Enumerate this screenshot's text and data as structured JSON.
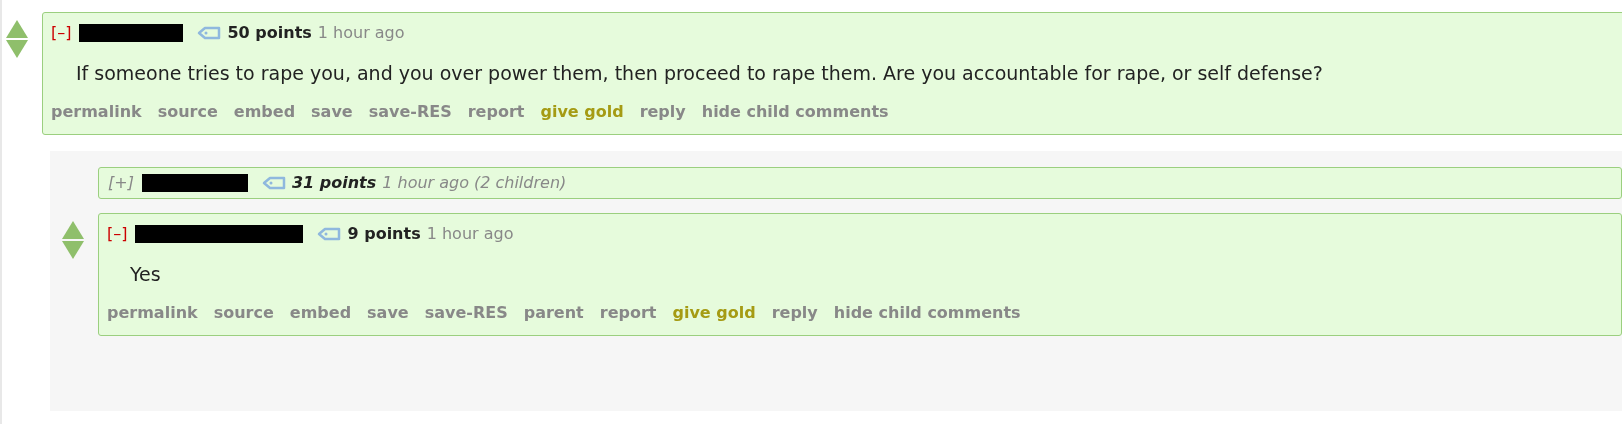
{
  "comments": [
    {
      "toggle": "[–]",
      "collapsed": false,
      "points": "50 points",
      "time": "1 hour ago",
      "body": "If someone tries to rape you, and you over power them, then proceed to rape them. Are you accountable for rape, or self defense?",
      "actions": [
        {
          "label": "permalink",
          "kind": "plain"
        },
        {
          "label": "source",
          "kind": "plain"
        },
        {
          "label": "embed",
          "kind": "plain"
        },
        {
          "label": "save",
          "kind": "plain"
        },
        {
          "label": "save-RES",
          "kind": "plain"
        },
        {
          "label": "report",
          "kind": "plain"
        },
        {
          "label": "give gold",
          "kind": "gold"
        },
        {
          "label": "reply",
          "kind": "plain"
        },
        {
          "label": "hide child comments",
          "kind": "plain"
        }
      ],
      "children": [
        {
          "toggle": "[+]",
          "collapsed": true,
          "points": "31 points",
          "time": "1 hour ago",
          "children_note": "(2 children)"
        },
        {
          "toggle": "[–]",
          "collapsed": false,
          "points": "9 points",
          "time": "1 hour ago",
          "body": "Yes",
          "actions": [
            {
              "label": "permalink",
              "kind": "plain"
            },
            {
              "label": "source",
              "kind": "plain"
            },
            {
              "label": "embed",
              "kind": "plain"
            },
            {
              "label": "save",
              "kind": "plain"
            },
            {
              "label": "save-RES",
              "kind": "plain"
            },
            {
              "label": "parent",
              "kind": "plain"
            },
            {
              "label": "report",
              "kind": "plain"
            },
            {
              "label": "give gold",
              "kind": "gold"
            },
            {
              "label": "reply",
              "kind": "plain"
            },
            {
              "label": "hide child comments",
              "kind": "plain"
            }
          ]
        }
      ]
    }
  ]
}
